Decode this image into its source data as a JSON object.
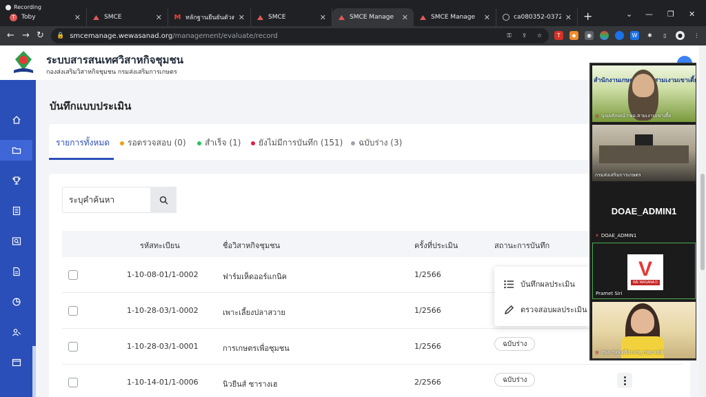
{
  "browser": {
    "recording_label": "Recording",
    "tabs": [
      {
        "title": "Toby",
        "icon": "toby-icon"
      },
      {
        "title": "SMCE",
        "icon": "smce-icon"
      },
      {
        "title": "หลักฐานยืนยันตัวตน - pra...",
        "icon": "gmail-icon"
      },
      {
        "title": "SMCE",
        "icon": "smce-icon"
      },
      {
        "title": "SMCE Manage",
        "icon": "smce-icon",
        "active": true
      },
      {
        "title": "SMCE Manage",
        "icon": "smce-icon"
      },
      {
        "title": "ca080352-0372-4b...",
        "icon": "globe-icon"
      }
    ],
    "url_host": "smcemanage.wewasanad.org",
    "url_path": "/management/evaluate/record"
  },
  "app": {
    "title": "ระบบสารสนเทศวิสาหกิจชุมชน",
    "subtitle": "กองส่งเสริมวิสาหกิจชุมชน กรมส่งเสริมการเกษตร"
  },
  "sidebar": {
    "items": [
      {
        "icon": "home-icon"
      },
      {
        "icon": "folder-icon",
        "active": true
      },
      {
        "icon": "trophy-icon"
      },
      {
        "icon": "list-icon"
      },
      {
        "icon": "search-doc-icon"
      },
      {
        "icon": "document-icon"
      },
      {
        "icon": "chart-icon"
      },
      {
        "icon": "users-icon"
      },
      {
        "icon": "window-icon"
      }
    ]
  },
  "page": {
    "heading": "บันทึกแบบประเมิน",
    "filter_tabs": [
      {
        "label": "รายการทั้งหมด",
        "active": true,
        "color": "#2b4fb8"
      },
      {
        "label": "รอตรวจสอบ (0)",
        "color": "#f59e0b"
      },
      {
        "label": "สำเร็จ (1)",
        "color": "#22c55e"
      },
      {
        "label": "ยังไม่มีการบันทึก (151)",
        "color": "#e11d48"
      },
      {
        "label": "ฉบับร่าง (3)",
        "color": "#9ca3af"
      }
    ],
    "search": {
      "placeholder": "ระบุคำค้นหา"
    },
    "columns": {
      "code": "รหัสทะเบียน",
      "name": "ชื่อวิสาหกิจชุมชน",
      "round": "ครั้งที่ประเมิน",
      "status": "สถานะการบันทึก"
    },
    "rows": [
      {
        "code": "1-10-08-01/1-0002",
        "name": "ฟาร์มเห็ดออร์แกนิค",
        "round": "1/2566",
        "status": ""
      },
      {
        "code": "1-10-28-03/1-0002",
        "name": "เพาะเลี้ยงปลาสวาย",
        "round": "1/2566",
        "status": ""
      },
      {
        "code": "1-10-28-03/1-0001",
        "name": "การเกษตรเพื่อชุมชน",
        "round": "1/2566",
        "status": "ฉบับร่าง"
      },
      {
        "code": "1-10-14-01/1-0006",
        "name": "นิวยีนส์ ซารางเฮ",
        "round": "2/2566",
        "status": "ฉบับร่าง"
      }
    ],
    "row_menu": {
      "record": "บันทึกผลประเมิน",
      "review": "ตรวจสอบผลประเมิน"
    }
  },
  "video_call": {
    "participants": [
      {
        "name": "บุณยลักษณ์ กษอ.สามเงามเขาเตี้ย",
        "banner": "สำนักงานเกษตรอำเภอสามเงามเขาเตี้ย",
        "muted": true
      },
      {
        "name": "กรมส่งเสริมการเกษตร",
        "muted": false
      },
      {
        "name": "DOAE_ADMIN1",
        "display": "DOAE_ADMIN1",
        "muted": true
      },
      {
        "name": "Pramet Siri",
        "logo_text": "WE WASANA D",
        "muted": false
      },
      {
        "name": "สนง.กษจ.ศรีสะเกษ_กษอ.หยุห์",
        "muted": true
      }
    ]
  }
}
